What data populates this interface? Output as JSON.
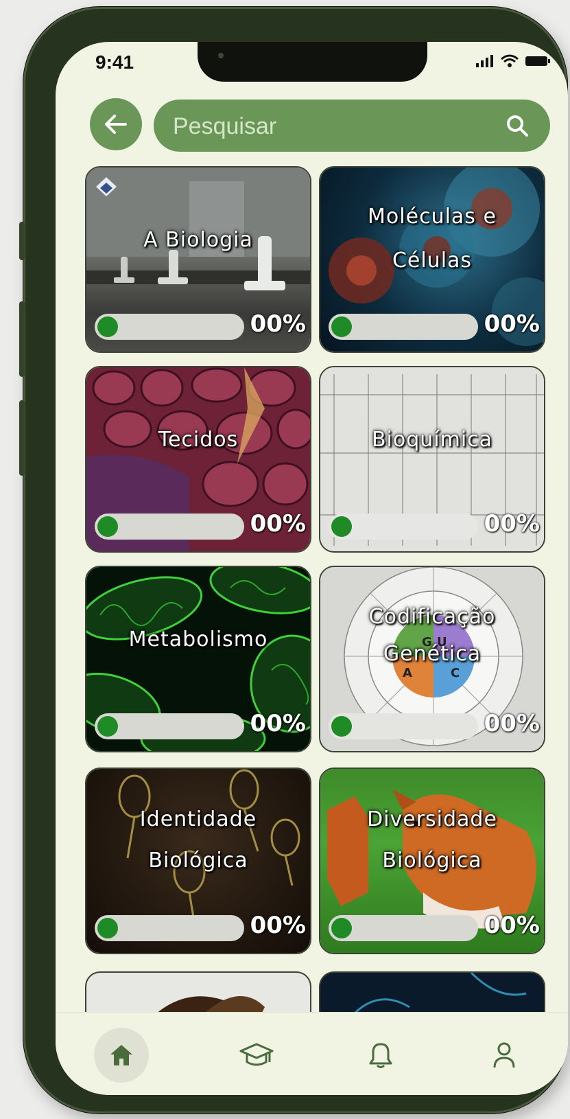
{
  "status_bar": {
    "time": "9:41",
    "icons": [
      "signal-icon",
      "wifi-icon",
      "battery-icon"
    ]
  },
  "header": {
    "back_icon": "arrow-left-icon",
    "search": {
      "placeholder": "Pesquisar",
      "value": "",
      "icon": "search-icon"
    }
  },
  "topics": [
    {
      "title": "A Biologia",
      "progress_label": "00%",
      "progress": 0
    },
    {
      "title": "Moléculas e Células",
      "progress_label": "00%",
      "progress": 0
    },
    {
      "title": "Tecidos",
      "progress_label": "00%",
      "progress": 0
    },
    {
      "title": "Bioquímica",
      "progress_label": "00%",
      "progress": 0
    },
    {
      "title": "Metabolismo",
      "progress_label": "00%",
      "progress": 0
    },
    {
      "title": "Codificação Genética",
      "progress_label": "00%",
      "progress": 0
    },
    {
      "title": "Identidade Biológica",
      "progress_label": "00%",
      "progress": 0
    },
    {
      "title": "Diversidade Biológica",
      "progress_label": "00%",
      "progress": 0
    }
  ],
  "bottom_nav": [
    {
      "icon": "home-icon",
      "active": true
    },
    {
      "icon": "graduation-cap-icon",
      "active": false
    },
    {
      "icon": "bell-icon",
      "active": false
    },
    {
      "icon": "user-icon",
      "active": false
    }
  ],
  "colors": {
    "accent": "#6a9758",
    "background": "#f1f4e2",
    "progress_fill": "#1f8b26",
    "progress_track": "#d8d8d3"
  }
}
